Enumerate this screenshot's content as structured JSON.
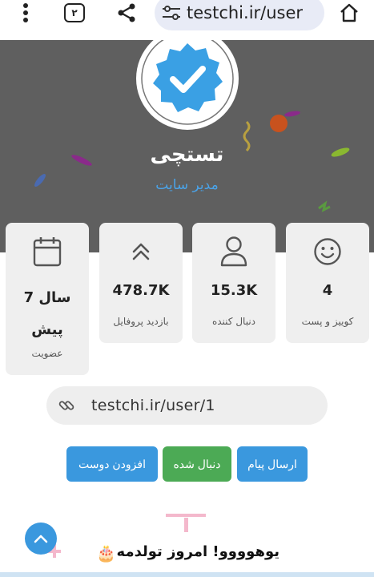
{
  "browser": {
    "tab_count": "۲",
    "url": "testchi.ir/user",
    "icons": [
      "menu-dots-icon",
      "tabs-icon",
      "share-icon",
      "tune-icon",
      "home-icon"
    ]
  },
  "profile": {
    "name": "تستچی",
    "role": "مدیر سایت",
    "verified_badge": "verified-check-icon"
  },
  "stats": [
    {
      "icon": "smiley-icon",
      "value": "4",
      "label": "کوییز و پست"
    },
    {
      "icon": "user-icon",
      "value": "15.3K",
      "label": "دنبال کننده"
    },
    {
      "icon": "double-chevron-up-icon",
      "value": "478.7K",
      "label": "بازدید پروفایل"
    },
    {
      "icon": "calendar-icon",
      "value": "7 سال پیش",
      "label": "عضویت"
    }
  ],
  "profile_link": {
    "text": "testchi.ir/user/1",
    "icon": "link-icon"
  },
  "actions": {
    "message": "ارسال پیام",
    "followed": "دنبال شده",
    "add_friend": "افزودن دوست"
  },
  "birthday": {
    "text": "یوهوووو! امروز تولدمه",
    "emoji": "🎂"
  },
  "colors": {
    "hero_bg": "#5f5f5f",
    "accent_blue": "#3a98de",
    "followed_green": "#4caa55",
    "role_blue": "#4aa3e8",
    "card_bg": "#efefef"
  }
}
